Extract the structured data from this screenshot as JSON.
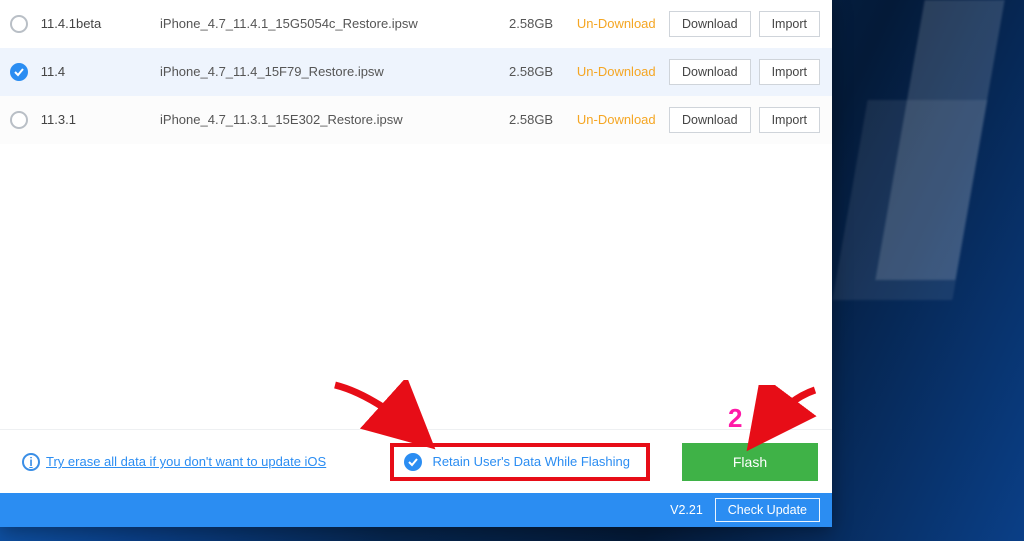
{
  "rows": [
    {
      "version": "11.4.1beta",
      "file": "iPhone_4.7_11.4.1_15G5054c_Restore.ipsw",
      "size": "2.58GB",
      "status": "Un-Download",
      "download": "Download",
      "import": "Import",
      "selected": false
    },
    {
      "version": "11.4",
      "file": "iPhone_4.7_11.4_15F79_Restore.ipsw",
      "size": "2.58GB",
      "status": "Un-Download",
      "download": "Download",
      "import": "Import",
      "selected": true
    },
    {
      "version": "11.3.1",
      "file": "iPhone_4.7_11.3.1_15E302_Restore.ipsw",
      "size": "2.58GB",
      "status": "Un-Download",
      "download": "Download",
      "import": "Import",
      "selected": false
    }
  ],
  "bottom": {
    "tip_link": "Try erase all data if you don't want to update iOS",
    "retain_label": "Retain User's Data While Flashing",
    "flash_label": "Flash"
  },
  "footer": {
    "version": "V2.21",
    "check_update": "Check Update"
  },
  "annotation": {
    "step_number": "2"
  }
}
